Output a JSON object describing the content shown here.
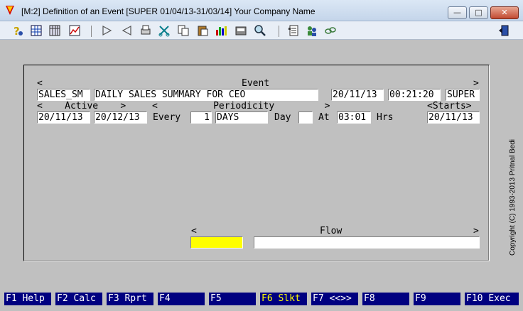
{
  "window": {
    "title": "[M:2]  Definition of an Event  [SUPER  01/04/13-31/03/14]  Your Company Name",
    "min_glyph": "—",
    "max_glyph": "□",
    "close_glyph": "✕"
  },
  "toolbar": {
    "icons": [
      "help-icon",
      "grid-icon",
      "table-icon",
      "chart-icon",
      "next-icon",
      "previous-icon",
      "print-icon",
      "cut-icon",
      "copy-icon",
      "paste-icon",
      "bar-chart-icon",
      "save-icon",
      "search-icon",
      "document-icon",
      "users-icon",
      "link-icon",
      "exit-icon"
    ]
  },
  "event_row": {
    "left_bracket": "<",
    "header": "Event",
    "right_bracket": ">",
    "code": "SALES_SM",
    "description": "DAILY SALES SUMMARY FOR CEO",
    "date": "20/11/13",
    "time": "00:21:20",
    "user": "SUPER"
  },
  "schedule_row": {
    "active_header": "<    Active    >",
    "periodicity_header": "<          Periodicity         >",
    "starts_header": "<Starts>",
    "active_from": "20/11/13",
    "active_to": "20/12/13",
    "every_label": "Every",
    "every_value": "1",
    "period_unit": "DAYS",
    "day_label": "Day",
    "day_value": "",
    "at_label": "At",
    "at_time": "03:01",
    "hrs_label": "Hrs",
    "starts": "20/11/13"
  },
  "flow": {
    "left_bracket": "<",
    "header": "Flow",
    "right_bracket": ">",
    "code_value": "",
    "flow_value": ""
  },
  "copyright": "Copyright (C) 1993-2013  Pritnal Bedi",
  "fkeys": [
    {
      "key": "F1",
      "label": "Help"
    },
    {
      "key": "F2",
      "label": "Calc"
    },
    {
      "key": "F3",
      "label": "Rprt"
    },
    {
      "key": "F4",
      "label": ""
    },
    {
      "key": "F5",
      "label": ""
    },
    {
      "key": "F6",
      "label": "Slkt"
    },
    {
      "key": "F7",
      "label": "<<>>"
    },
    {
      "key": "F8",
      "label": ""
    },
    {
      "key": "F9",
      "label": ""
    },
    {
      "key": "F10",
      "label": "Exec"
    }
  ],
  "colors": {
    "background": "#c0c0c0",
    "fkey_bar": "#000080",
    "highlight_field": "#ffff00"
  }
}
